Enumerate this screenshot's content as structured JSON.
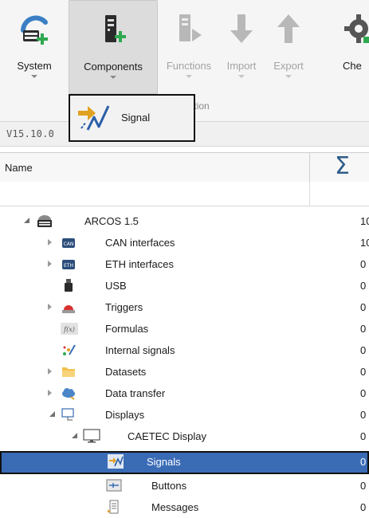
{
  "ribbon": {
    "buttons": [
      {
        "label": "System",
        "icon": "system-add-icon",
        "enabled": true
      },
      {
        "label": "Components",
        "icon": "components-add-icon",
        "enabled": true,
        "active": true
      },
      {
        "label": "Functions",
        "icon": "functions-icon",
        "enabled": false
      },
      {
        "label": "Import",
        "icon": "import-icon",
        "enabled": false
      },
      {
        "label": "Export",
        "icon": "export-icon",
        "enabled": false
      },
      {
        "label": "Che",
        "icon": "check-icon",
        "enabled": true
      }
    ],
    "group_label": "onfiguration"
  },
  "dropdown": {
    "item_label": "Signal",
    "icon": "signal-icon"
  },
  "version": "V15.10.0",
  "grid": {
    "col_name": "Name",
    "col_sum_icon": "Σ"
  },
  "tree": [
    {
      "label": "ARCOS 1.5",
      "value": "10",
      "level": 0,
      "expander": "expanded",
      "icon": "device-icon"
    },
    {
      "label": "CAN interfaces",
      "value": "10",
      "level": 1,
      "expander": "collapsed",
      "icon": "can-icon"
    },
    {
      "label": "ETH interfaces",
      "value": "0",
      "level": 1,
      "expander": "collapsed",
      "icon": "eth-icon"
    },
    {
      "label": "USB",
      "value": "0",
      "level": 1,
      "expander": "none",
      "icon": "usb-icon"
    },
    {
      "label": "Triggers",
      "value": "0",
      "level": 1,
      "expander": "collapsed",
      "icon": "trigger-icon"
    },
    {
      "label": "Formulas",
      "value": "0",
      "level": 1,
      "expander": "none",
      "icon": "formula-icon"
    },
    {
      "label": "Internal signals",
      "value": "0",
      "level": 1,
      "expander": "none",
      "icon": "internal-signals-icon"
    },
    {
      "label": "Datasets",
      "value": "0",
      "level": 1,
      "expander": "collapsed",
      "icon": "folder-icon"
    },
    {
      "label": "Data transfer",
      "value": "0",
      "level": 1,
      "expander": "collapsed",
      "icon": "cloud-icon"
    },
    {
      "label": "Displays",
      "value": "0",
      "level": 1,
      "expander": "expanded",
      "icon": "displays-icon"
    },
    {
      "label": "CAETEC Display",
      "value": "0",
      "level": 2,
      "expander": "expanded",
      "icon": "monitor-icon"
    },
    {
      "label": "Signals",
      "value": "0",
      "level": 3,
      "expander": "none",
      "icon": "signals-icon",
      "selected": true
    },
    {
      "label": "Buttons",
      "value": "0",
      "level": 3,
      "expander": "none",
      "icon": "buttons-icon"
    },
    {
      "label": "Messages",
      "value": "0",
      "level": 3,
      "expander": "none",
      "icon": "messages-icon"
    }
  ],
  "colors": {
    "selection": "#3a6bb5",
    "accent_green": "#2fa84f",
    "sigma": "#2e5c8a"
  }
}
